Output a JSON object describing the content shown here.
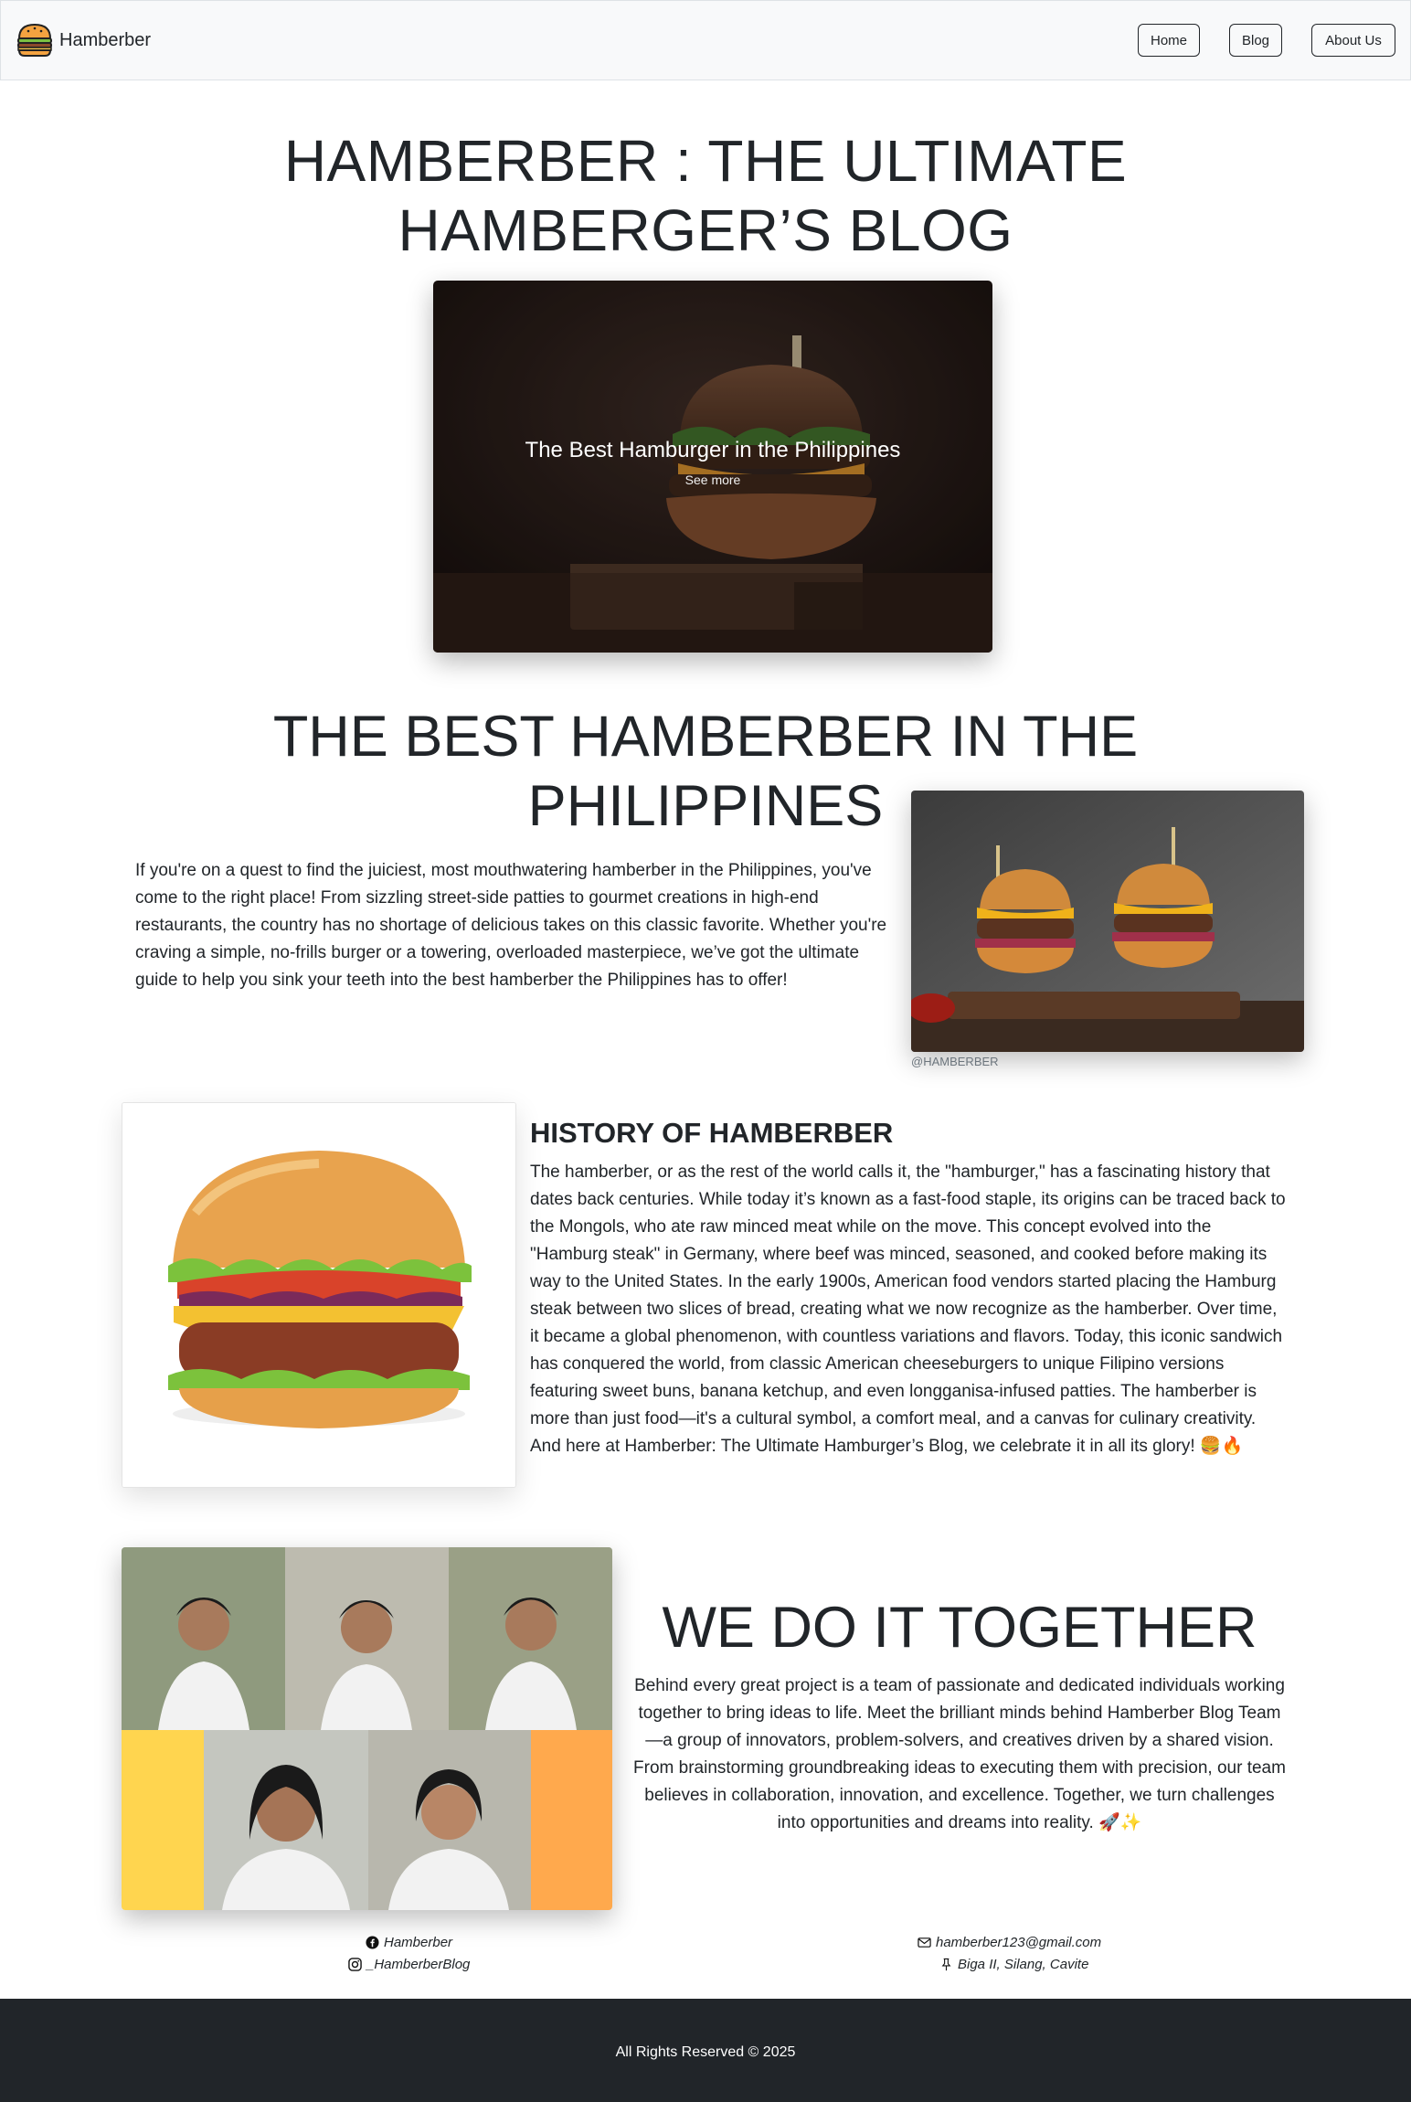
{
  "navbar": {
    "brand_name": "Hamberber",
    "links": [
      {
        "label": "Home"
      },
      {
        "label": "Blog"
      },
      {
        "label": "About Us"
      }
    ]
  },
  "hero": {
    "title": "HAMBERBER : THE ULTIMATE HAMBERGER’S BLOG",
    "carousel": {
      "caption_title": "The Best Hamburger in the Philippines",
      "caption_link": "See more"
    }
  },
  "best_section": {
    "title": "THE BEST HAMBERBER IN THE PHILIPPINES",
    "text": "If you're on a quest to find the juiciest, most mouthwatering hamberber in the Philippines, you've come to the right place! From sizzling street-side patties to gourmet creations in high-end restaurants, the country has no shortage of delicious takes on this classic favorite. Whether you're craving a simple, no-frills burger or a towering, overloaded masterpiece, we’ve got the ultimate guide to help you sink your teeth into the best hamberber the Philippines has to offer!",
    "image_credit": "@HAMBERBER"
  },
  "history_section": {
    "title": "HISTORY OF HAMBERBER",
    "text": "The hamberber, or as the rest of the world calls it, the \"hamburger,\" has a fascinating history that dates back centuries. While today it’s known as a fast-food staple, its origins can be traced back to the Mongols, who ate raw minced meat while on the move. This concept evolved into the \"Hamburg steak\" in Germany, where beef was minced, seasoned, and cooked before making its way to the United States. In the early 1900s, American food vendors started placing the Hamburg steak between two slices of bread, creating what we now recognize as the hamberber. Over time, it became a global phenomenon, with countless variations and flavors. Today, this iconic sandwich has conquered the world, from classic American cheeseburgers to unique Filipino versions featuring sweet buns, banana ketchup, and even longganisa-infused patties. The hamberber is more than just food—it's a cultural symbol, a comfort meal, and a canvas for culinary creativity. And here at Hamberber: The Ultimate Hamburger’s Blog, we celebrate it in all its glory! 🍔🔥"
  },
  "team_section": {
    "title": "WE DO IT TOGETHER",
    "text": "Behind every great project is a team of passionate and dedicated individuals working together to bring ideas to life. Meet the brilliant minds behind Hamberber Blog Team—a group of innovators, problem-solvers, and creatives driven by a shared vision. From brainstorming groundbreaking ideas to executing them with precision, our team believes in collaboration, innovation, and excellence. Together, we turn challenges into opportunities and dreams into reality. 🚀✨"
  },
  "contact": {
    "facebook": "Hamberber",
    "instagram": "_HamberberBlog",
    "email": "hamberber123@gmail.com",
    "location": "Biga II, Silang, Cavite",
    "icons": [
      "facebook-icon",
      "instagram-icon",
      "envelope-icon",
      "pin-icon"
    ]
  },
  "footer": {
    "text": "All Rights Reserved © 2025"
  },
  "colors": {
    "navbar_bg": "#f8f9fa",
    "footer_bg": "#212529",
    "text": "#212529",
    "team_bg_left": "#ffd54f",
    "team_bg_right": "#ffa94d"
  }
}
